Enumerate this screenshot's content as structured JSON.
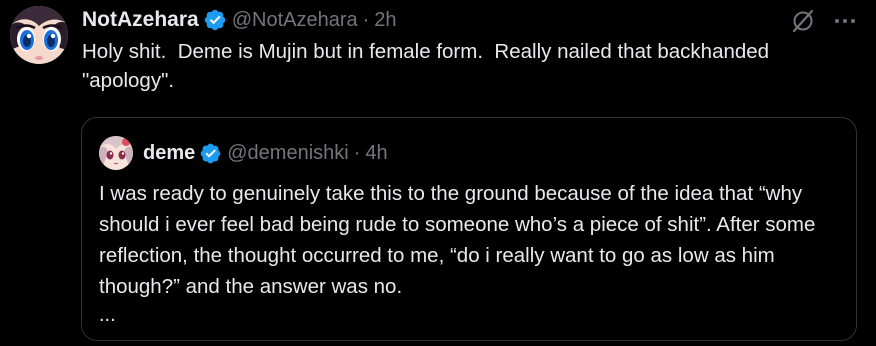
{
  "post": {
    "author_name": "NotAzehara",
    "author_handle": "@NotAzehara",
    "separator": "·",
    "time": "2h",
    "text": "Holy shit.  Deme is Mujin but in female form.  Really nailed that backhanded \"apology\".",
    "avatar_icon": "anime-avatar-icon",
    "verified_icon": "verified-badge-icon",
    "actions": [
      "grok-icon",
      "more-icon"
    ],
    "colors": {
      "background": "#000000",
      "text": "#e7e9ea",
      "muted": "#71767b",
      "verified": "#1d9bf0",
      "border": "#2f3336"
    }
  },
  "quote": {
    "author_name": "deme",
    "author_handle": "@demenishki",
    "separator": "·",
    "time": "4h",
    "text": "I was ready to genuinely take this to the ground because of the idea that “why should i ever feel bad being rude to someone who’s a piece of shit”. After some reflection, the thought occurred to me, “do i really want to go as low as him though?” and the answer was no.",
    "ellipsis": "...",
    "avatar_icon": "anime-avatar-icon",
    "verified_icon": "verified-badge-icon"
  }
}
